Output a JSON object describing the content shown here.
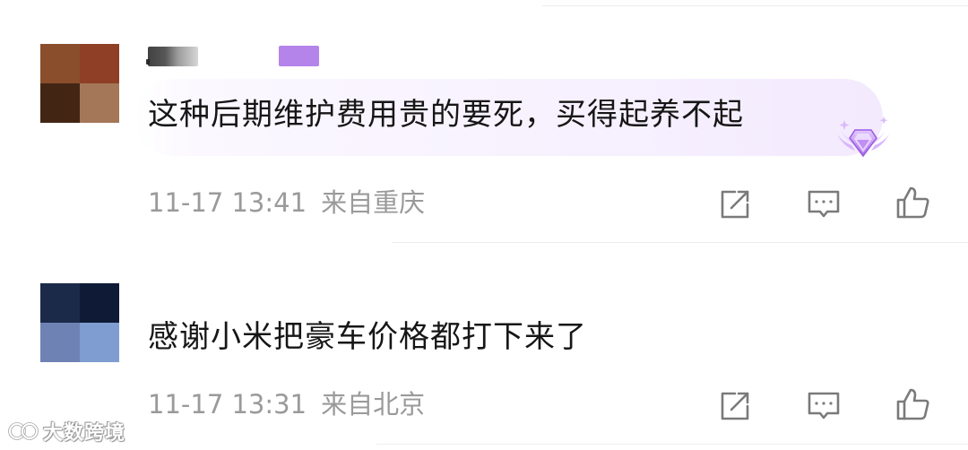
{
  "comments": [
    {
      "text": "这种后期维护费用贵的要死，买得起养不起",
      "time": "11-17 13:41",
      "location": "来自重庆",
      "avatar_colors": [
        "#8a4e2c",
        "#8e3f26",
        "#432514",
        "#a47758"
      ],
      "badge_color": "#b584ea"
    },
    {
      "text": "感谢小米把豪车价格都打下来了",
      "time": "11-17 13:31",
      "location": "来自北京",
      "avatar_colors": [
        "#1c2a4a",
        "#0f1b36",
        "#6e83b4",
        "#7f9dd1"
      ]
    }
  ],
  "icons": {
    "share": "share-icon",
    "comment": "comment-icon",
    "like": "like-icon",
    "vip": "diamond-vip-icon"
  },
  "watermark": {
    "text": "大数跨境"
  },
  "colors": {
    "meta_text": "#9a9a9a",
    "icon_stroke": "#7a7a7a",
    "bubble": "#f6effe",
    "vip": "#b77ff0"
  }
}
